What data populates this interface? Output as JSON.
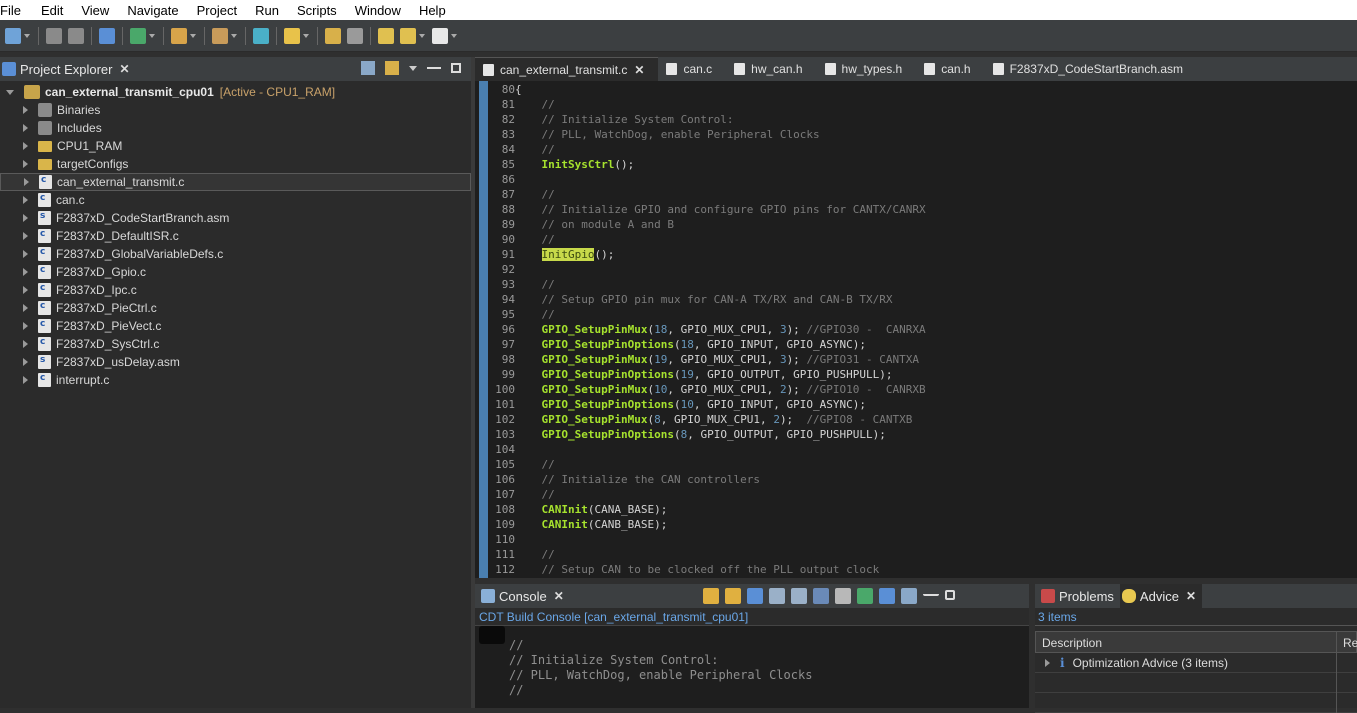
{
  "menu": [
    "File",
    "Edit",
    "View",
    "Navigate",
    "Project",
    "Run",
    "Scripts",
    "Window",
    "Help"
  ],
  "explorer": {
    "tab_label": "Project Explorer",
    "project": {
      "name": "can_external_transmit_cpu01",
      "status": "[Active - CPU1_RAM]"
    },
    "items": [
      {
        "label": "Binaries",
        "icon": "binaries-icon"
      },
      {
        "label": "Includes",
        "icon": "includes-icon"
      },
      {
        "label": "CPU1_RAM",
        "icon": "folder-icon"
      },
      {
        "label": "targetConfigs",
        "icon": "folder-icon"
      },
      {
        "label": "can_external_transmit.c",
        "icon": "c-file-icon"
      },
      {
        "label": "can.c",
        "icon": "c-file-icon"
      },
      {
        "label": "F2837xD_CodeStartBranch.asm",
        "icon": "asm-file-icon"
      },
      {
        "label": "F2837xD_DefaultISR.c",
        "icon": "c-file-icon"
      },
      {
        "label": "F2837xD_GlobalVariableDefs.c",
        "icon": "c-file-icon"
      },
      {
        "label": "F2837xD_Gpio.c",
        "icon": "c-file-icon"
      },
      {
        "label": "F2837xD_Ipc.c",
        "icon": "c-file-icon"
      },
      {
        "label": "F2837xD_PieCtrl.c",
        "icon": "c-file-icon"
      },
      {
        "label": "F2837xD_PieVect.c",
        "icon": "c-file-icon"
      },
      {
        "label": "F2837xD_SysCtrl.c",
        "icon": "c-file-icon"
      },
      {
        "label": "F2837xD_usDelay.asm",
        "icon": "asm-file-icon"
      },
      {
        "label": "interrupt.c",
        "icon": "c-file-icon"
      }
    ]
  },
  "editor": {
    "tabs": [
      "can_external_transmit.c",
      "can.c",
      "hw_can.h",
      "hw_types.h",
      "can.h",
      "F2837xD_CodeStartBranch.asm"
    ],
    "lines": [
      {
        "n": "80",
        "parts": [
          [
            "plain",
            "{"
          ]
        ]
      },
      {
        "n": "81",
        "parts": [
          [
            "comment",
            "    //"
          ]
        ]
      },
      {
        "n": "82",
        "parts": [
          [
            "comment",
            "    // Initialize System Control:"
          ]
        ]
      },
      {
        "n": "83",
        "parts": [
          [
            "comment",
            "    // PLL, WatchDog, enable Peripheral Clocks"
          ]
        ]
      },
      {
        "n": "84",
        "parts": [
          [
            "comment",
            "    //"
          ]
        ]
      },
      {
        "n": "85",
        "parts": [
          [
            "plain",
            "    "
          ],
          [
            "func",
            "InitSysCtrl"
          ],
          [
            "plain",
            "();"
          ]
        ]
      },
      {
        "n": "86",
        "parts": [
          [
            "plain",
            ""
          ]
        ]
      },
      {
        "n": "87",
        "parts": [
          [
            "comment",
            "    //"
          ]
        ]
      },
      {
        "n": "88",
        "parts": [
          [
            "comment",
            "    // Initialize GPIO and configure GPIO pins for CANTX/CANRX"
          ]
        ]
      },
      {
        "n": "89",
        "parts": [
          [
            "comment",
            "    // on module A and B"
          ]
        ]
      },
      {
        "n": "90",
        "parts": [
          [
            "comment",
            "    //"
          ]
        ]
      },
      {
        "n": "91",
        "parts": [
          [
            "plain",
            "    "
          ],
          [
            "hl",
            "InitGpio"
          ],
          [
            "plain",
            "();"
          ]
        ]
      },
      {
        "n": "92",
        "parts": [
          [
            "plain",
            ""
          ]
        ]
      },
      {
        "n": "93",
        "parts": [
          [
            "comment",
            "    //"
          ]
        ]
      },
      {
        "n": "94",
        "parts": [
          [
            "comment",
            "    // Setup GPIO pin mux for CAN-A TX/RX and CAN-B TX/RX"
          ]
        ]
      },
      {
        "n": "95",
        "parts": [
          [
            "comment",
            "    //"
          ]
        ]
      },
      {
        "n": "96",
        "parts": [
          [
            "plain",
            "    "
          ],
          [
            "func",
            "GPIO_SetupPinMux"
          ],
          [
            "plain",
            "("
          ],
          [
            "num",
            "18"
          ],
          [
            "plain",
            ", GPIO_MUX_CPU1, "
          ],
          [
            "num",
            "3"
          ],
          [
            "plain",
            "); "
          ],
          [
            "comment",
            "//GPIO30 -  CANRXA"
          ]
        ]
      },
      {
        "n": "97",
        "parts": [
          [
            "plain",
            "    "
          ],
          [
            "func",
            "GPIO_SetupPinOptions"
          ],
          [
            "plain",
            "("
          ],
          [
            "num",
            "18"
          ],
          [
            "plain",
            ", GPIO_INPUT, GPIO_ASYNC);"
          ]
        ]
      },
      {
        "n": "98",
        "parts": [
          [
            "plain",
            "    "
          ],
          [
            "func",
            "GPIO_SetupPinMux"
          ],
          [
            "plain",
            "("
          ],
          [
            "num",
            "19"
          ],
          [
            "plain",
            ", GPIO_MUX_CPU1, "
          ],
          [
            "num",
            "3"
          ],
          [
            "plain",
            "); "
          ],
          [
            "comment",
            "//GPIO31 - CANTXA"
          ]
        ]
      },
      {
        "n": "99",
        "parts": [
          [
            "plain",
            "    "
          ],
          [
            "func",
            "GPIO_SetupPinOptions"
          ],
          [
            "plain",
            "("
          ],
          [
            "num",
            "19"
          ],
          [
            "plain",
            ", GPIO_OUTPUT, GPIO_PUSHPULL);"
          ]
        ]
      },
      {
        "n": "100",
        "parts": [
          [
            "plain",
            "    "
          ],
          [
            "func",
            "GPIO_SetupPinMux"
          ],
          [
            "plain",
            "("
          ],
          [
            "num",
            "10"
          ],
          [
            "plain",
            ", GPIO_MUX_CPU1, "
          ],
          [
            "num",
            "2"
          ],
          [
            "plain",
            "); "
          ],
          [
            "comment",
            "//GPIO10 -  CANRXB"
          ]
        ]
      },
      {
        "n": "101",
        "parts": [
          [
            "plain",
            "    "
          ],
          [
            "func",
            "GPIO_SetupPinOptions"
          ],
          [
            "plain",
            "("
          ],
          [
            "num",
            "10"
          ],
          [
            "plain",
            ", GPIO_INPUT, GPIO_ASYNC);"
          ]
        ]
      },
      {
        "n": "102",
        "parts": [
          [
            "plain",
            "    "
          ],
          [
            "func",
            "GPIO_SetupPinMux"
          ],
          [
            "plain",
            "("
          ],
          [
            "num",
            "8"
          ],
          [
            "plain",
            ", GPIO_MUX_CPU1, "
          ],
          [
            "num",
            "2"
          ],
          [
            "plain",
            ");  "
          ],
          [
            "comment",
            "//GPIO8 - CANTXB"
          ]
        ]
      },
      {
        "n": "103",
        "parts": [
          [
            "plain",
            "    "
          ],
          [
            "func",
            "GPIO_SetupPinOptions"
          ],
          [
            "plain",
            "("
          ],
          [
            "num",
            "8"
          ],
          [
            "plain",
            ", GPIO_OUTPUT, GPIO_PUSHPULL);"
          ]
        ]
      },
      {
        "n": "104",
        "parts": [
          [
            "plain",
            ""
          ]
        ]
      },
      {
        "n": "105",
        "parts": [
          [
            "comment",
            "    //"
          ]
        ]
      },
      {
        "n": "106",
        "parts": [
          [
            "comment",
            "    // Initialize the CAN controllers"
          ]
        ]
      },
      {
        "n": "107",
        "parts": [
          [
            "comment",
            "    //"
          ]
        ]
      },
      {
        "n": "108",
        "parts": [
          [
            "plain",
            "    "
          ],
          [
            "func",
            "CANInit"
          ],
          [
            "plain",
            "(CANA_BASE);"
          ]
        ]
      },
      {
        "n": "109",
        "parts": [
          [
            "plain",
            "    "
          ],
          [
            "func",
            "CANInit"
          ],
          [
            "plain",
            "(CANB_BASE);"
          ]
        ]
      },
      {
        "n": "110",
        "parts": [
          [
            "plain",
            ""
          ]
        ]
      },
      {
        "n": "111",
        "parts": [
          [
            "comment",
            "    //"
          ]
        ]
      },
      {
        "n": "112",
        "parts": [
          [
            "comment",
            "    // Setup CAN to be clocked off the PLL output clock"
          ]
        ]
      }
    ]
  },
  "console": {
    "tab_label": "Console",
    "title": "CDT Build Console [can_external_transmit_cpu01]",
    "lines": [
      "//",
      "// Initialize System Control:",
      "// PLL, WatchDog, enable Peripheral Clocks",
      "//"
    ]
  },
  "advice": {
    "tabs": [
      "Problems",
      "Advice"
    ],
    "count": "3 items",
    "columns": [
      "Description",
      "Re"
    ],
    "rows": [
      "Optimization Advice (3 items)"
    ]
  }
}
